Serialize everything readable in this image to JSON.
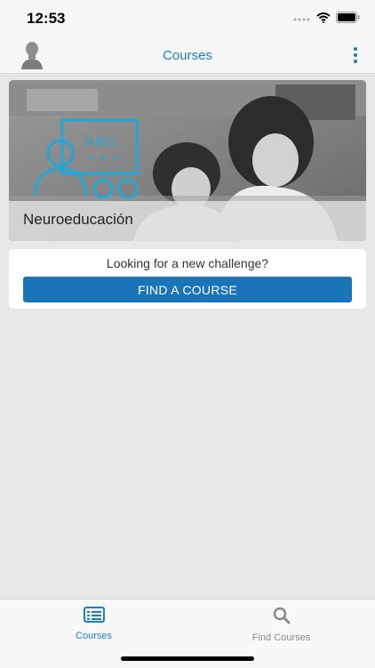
{
  "status_bar": {
    "time": "12:53"
  },
  "nav": {
    "title": "Courses"
  },
  "course": {
    "title": "Neuroeducación",
    "icon_text": "ABC"
  },
  "challenge": {
    "prompt": "Looking for a new challenge?",
    "button_label": "FIND A COURSE"
  },
  "tabs": [
    {
      "label": "Courses",
      "icon": "list-icon",
      "active": true
    },
    {
      "label": "Find Courses",
      "icon": "search-icon",
      "active": false
    }
  ],
  "colors": {
    "accent": "#1c7fc1",
    "button": "#1a74b7",
    "illustration": "#1fa8d8"
  }
}
